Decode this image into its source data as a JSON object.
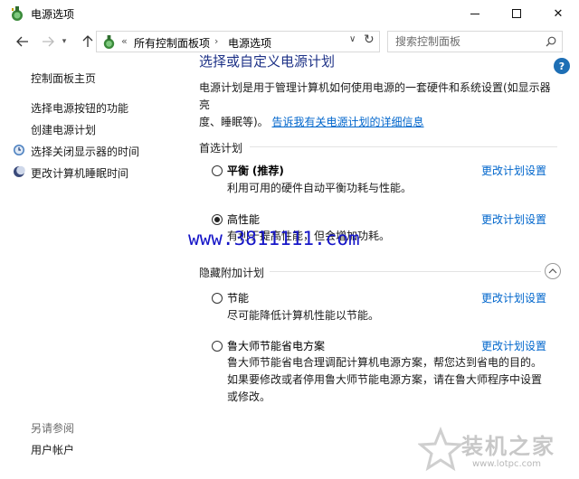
{
  "window": {
    "title": "电源选项",
    "minimize_label": "—",
    "close_label": "✕"
  },
  "navigation": {
    "recent_glyph": "▾",
    "breadcrumb_sep": "«",
    "breadcrumbs": [
      "所有控制面板项",
      "电源选项"
    ],
    "crumb_arrow": "›",
    "dropdown_glyph": "∨",
    "refresh_glyph": "↻",
    "search_placeholder": "搜索控制面板"
  },
  "help": {
    "label": "?"
  },
  "sidebar": {
    "home": "控制面板主页",
    "links": [
      "选择电源按钮的功能",
      "创建电源计划",
      "选择关闭显示器的时间",
      "更改计算机睡眠时间"
    ],
    "see_also_title": "另请参阅",
    "see_also_links": [
      "用户帐户"
    ]
  },
  "main": {
    "title": "选择或自定义电源计划",
    "description_line1": "电源计划是用于管理计算机如何使用电源的一套硬件和系统设置(如显示器亮",
    "description_line2": "度、睡眠等)。",
    "description_link": "告诉我有关电源计划的详细信息",
    "preferred_group": "首选计划",
    "hidden_group": "隐藏附加计划",
    "change_settings": "更改计划设置",
    "plans": [
      {
        "name": "平衡",
        "tag": "(推荐)",
        "desc": "利用可用的硬件自动平衡功耗与性能。",
        "checked": false
      },
      {
        "name": "高性能",
        "tag": "",
        "desc": "有利于提高性能，但会增加功耗。",
        "checked": true
      },
      {
        "name": "节能",
        "tag": "",
        "desc": "尽可能降低计算机性能以节能。",
        "checked": false
      },
      {
        "name": "鲁大师节能省电方案",
        "tag": "",
        "desc": "鲁大师节能省电合理调配计算机电源方案，帮您达到省电的目的。如果要修改或者停用鲁大师节能电源方案，请在鲁大师程序中设置或修改。",
        "checked": false
      }
    ]
  },
  "watermark": {
    "url": "www.3811111.com",
    "brand": "装机之家",
    "site": "www.lotpc.com"
  },
  "colors": {
    "title_blue": "#1e3287",
    "link_blue": "#0066cc",
    "help_blue": "#1e6fb5",
    "watermark_blue": "#1616c8"
  }
}
